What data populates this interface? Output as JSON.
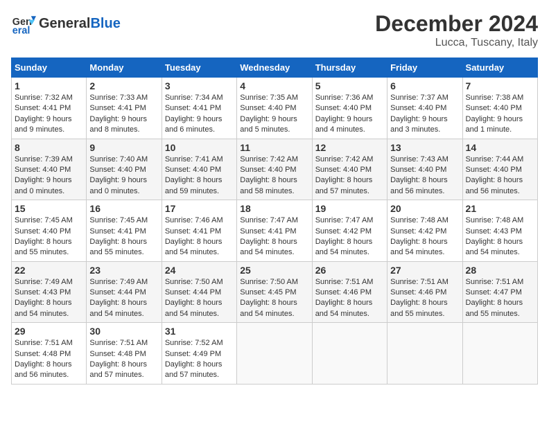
{
  "header": {
    "logo_line1": "General",
    "logo_line2": "Blue",
    "main_title": "December 2024",
    "subtitle": "Lucca, Tuscany, Italy"
  },
  "columns": [
    "Sunday",
    "Monday",
    "Tuesday",
    "Wednesday",
    "Thursday",
    "Friday",
    "Saturday"
  ],
  "weeks": [
    [
      {
        "day": "1",
        "sunrise": "Sunrise: 7:32 AM",
        "sunset": "Sunset: 4:41 PM",
        "daylight": "Daylight: 9 hours and 9 minutes."
      },
      {
        "day": "2",
        "sunrise": "Sunrise: 7:33 AM",
        "sunset": "Sunset: 4:41 PM",
        "daylight": "Daylight: 9 hours and 8 minutes."
      },
      {
        "day": "3",
        "sunrise": "Sunrise: 7:34 AM",
        "sunset": "Sunset: 4:41 PM",
        "daylight": "Daylight: 9 hours and 6 minutes."
      },
      {
        "day": "4",
        "sunrise": "Sunrise: 7:35 AM",
        "sunset": "Sunset: 4:40 PM",
        "daylight": "Daylight: 9 hours and 5 minutes."
      },
      {
        "day": "5",
        "sunrise": "Sunrise: 7:36 AM",
        "sunset": "Sunset: 4:40 PM",
        "daylight": "Daylight: 9 hours and 4 minutes."
      },
      {
        "day": "6",
        "sunrise": "Sunrise: 7:37 AM",
        "sunset": "Sunset: 4:40 PM",
        "daylight": "Daylight: 9 hours and 3 minutes."
      },
      {
        "day": "7",
        "sunrise": "Sunrise: 7:38 AM",
        "sunset": "Sunset: 4:40 PM",
        "daylight": "Daylight: 9 hours and 1 minute."
      }
    ],
    [
      {
        "day": "8",
        "sunrise": "Sunrise: 7:39 AM",
        "sunset": "Sunset: 4:40 PM",
        "daylight": "Daylight: 9 hours and 0 minutes."
      },
      {
        "day": "9",
        "sunrise": "Sunrise: 7:40 AM",
        "sunset": "Sunset: 4:40 PM",
        "daylight": "Daylight: 9 hours and 0 minutes."
      },
      {
        "day": "10",
        "sunrise": "Sunrise: 7:41 AM",
        "sunset": "Sunset: 4:40 PM",
        "daylight": "Daylight: 8 hours and 59 minutes."
      },
      {
        "day": "11",
        "sunrise": "Sunrise: 7:42 AM",
        "sunset": "Sunset: 4:40 PM",
        "daylight": "Daylight: 8 hours and 58 minutes."
      },
      {
        "day": "12",
        "sunrise": "Sunrise: 7:42 AM",
        "sunset": "Sunset: 4:40 PM",
        "daylight": "Daylight: 8 hours and 57 minutes."
      },
      {
        "day": "13",
        "sunrise": "Sunrise: 7:43 AM",
        "sunset": "Sunset: 4:40 PM",
        "daylight": "Daylight: 8 hours and 56 minutes."
      },
      {
        "day": "14",
        "sunrise": "Sunrise: 7:44 AM",
        "sunset": "Sunset: 4:40 PM",
        "daylight": "Daylight: 8 hours and 56 minutes."
      }
    ],
    [
      {
        "day": "15",
        "sunrise": "Sunrise: 7:45 AM",
        "sunset": "Sunset: 4:40 PM",
        "daylight": "Daylight: 8 hours and 55 minutes."
      },
      {
        "day": "16",
        "sunrise": "Sunrise: 7:45 AM",
        "sunset": "Sunset: 4:41 PM",
        "daylight": "Daylight: 8 hours and 55 minutes."
      },
      {
        "day": "17",
        "sunrise": "Sunrise: 7:46 AM",
        "sunset": "Sunset: 4:41 PM",
        "daylight": "Daylight: 8 hours and 54 minutes."
      },
      {
        "day": "18",
        "sunrise": "Sunrise: 7:47 AM",
        "sunset": "Sunset: 4:41 PM",
        "daylight": "Daylight: 8 hours and 54 minutes."
      },
      {
        "day": "19",
        "sunrise": "Sunrise: 7:47 AM",
        "sunset": "Sunset: 4:42 PM",
        "daylight": "Daylight: 8 hours and 54 minutes."
      },
      {
        "day": "20",
        "sunrise": "Sunrise: 7:48 AM",
        "sunset": "Sunset: 4:42 PM",
        "daylight": "Daylight: 8 hours and 54 minutes."
      },
      {
        "day": "21",
        "sunrise": "Sunrise: 7:48 AM",
        "sunset": "Sunset: 4:43 PM",
        "daylight": "Daylight: 8 hours and 54 minutes."
      }
    ],
    [
      {
        "day": "22",
        "sunrise": "Sunrise: 7:49 AM",
        "sunset": "Sunset: 4:43 PM",
        "daylight": "Daylight: 8 hours and 54 minutes."
      },
      {
        "day": "23",
        "sunrise": "Sunrise: 7:49 AM",
        "sunset": "Sunset: 4:44 PM",
        "daylight": "Daylight: 8 hours and 54 minutes."
      },
      {
        "day": "24",
        "sunrise": "Sunrise: 7:50 AM",
        "sunset": "Sunset: 4:44 PM",
        "daylight": "Daylight: 8 hours and 54 minutes."
      },
      {
        "day": "25",
        "sunrise": "Sunrise: 7:50 AM",
        "sunset": "Sunset: 4:45 PM",
        "daylight": "Daylight: 8 hours and 54 minutes."
      },
      {
        "day": "26",
        "sunrise": "Sunrise: 7:51 AM",
        "sunset": "Sunset: 4:46 PM",
        "daylight": "Daylight: 8 hours and 54 minutes."
      },
      {
        "day": "27",
        "sunrise": "Sunrise: 7:51 AM",
        "sunset": "Sunset: 4:46 PM",
        "daylight": "Daylight: 8 hours and 55 minutes."
      },
      {
        "day": "28",
        "sunrise": "Sunrise: 7:51 AM",
        "sunset": "Sunset: 4:47 PM",
        "daylight": "Daylight: 8 hours and 55 minutes."
      }
    ],
    [
      {
        "day": "29",
        "sunrise": "Sunrise: 7:51 AM",
        "sunset": "Sunset: 4:48 PM",
        "daylight": "Daylight: 8 hours and 56 minutes."
      },
      {
        "day": "30",
        "sunrise": "Sunrise: 7:51 AM",
        "sunset": "Sunset: 4:48 PM",
        "daylight": "Daylight: 8 hours and 57 minutes."
      },
      {
        "day": "31",
        "sunrise": "Sunrise: 7:52 AM",
        "sunset": "Sunset: 4:49 PM",
        "daylight": "Daylight: 8 hours and 57 minutes."
      },
      null,
      null,
      null,
      null
    ]
  ]
}
